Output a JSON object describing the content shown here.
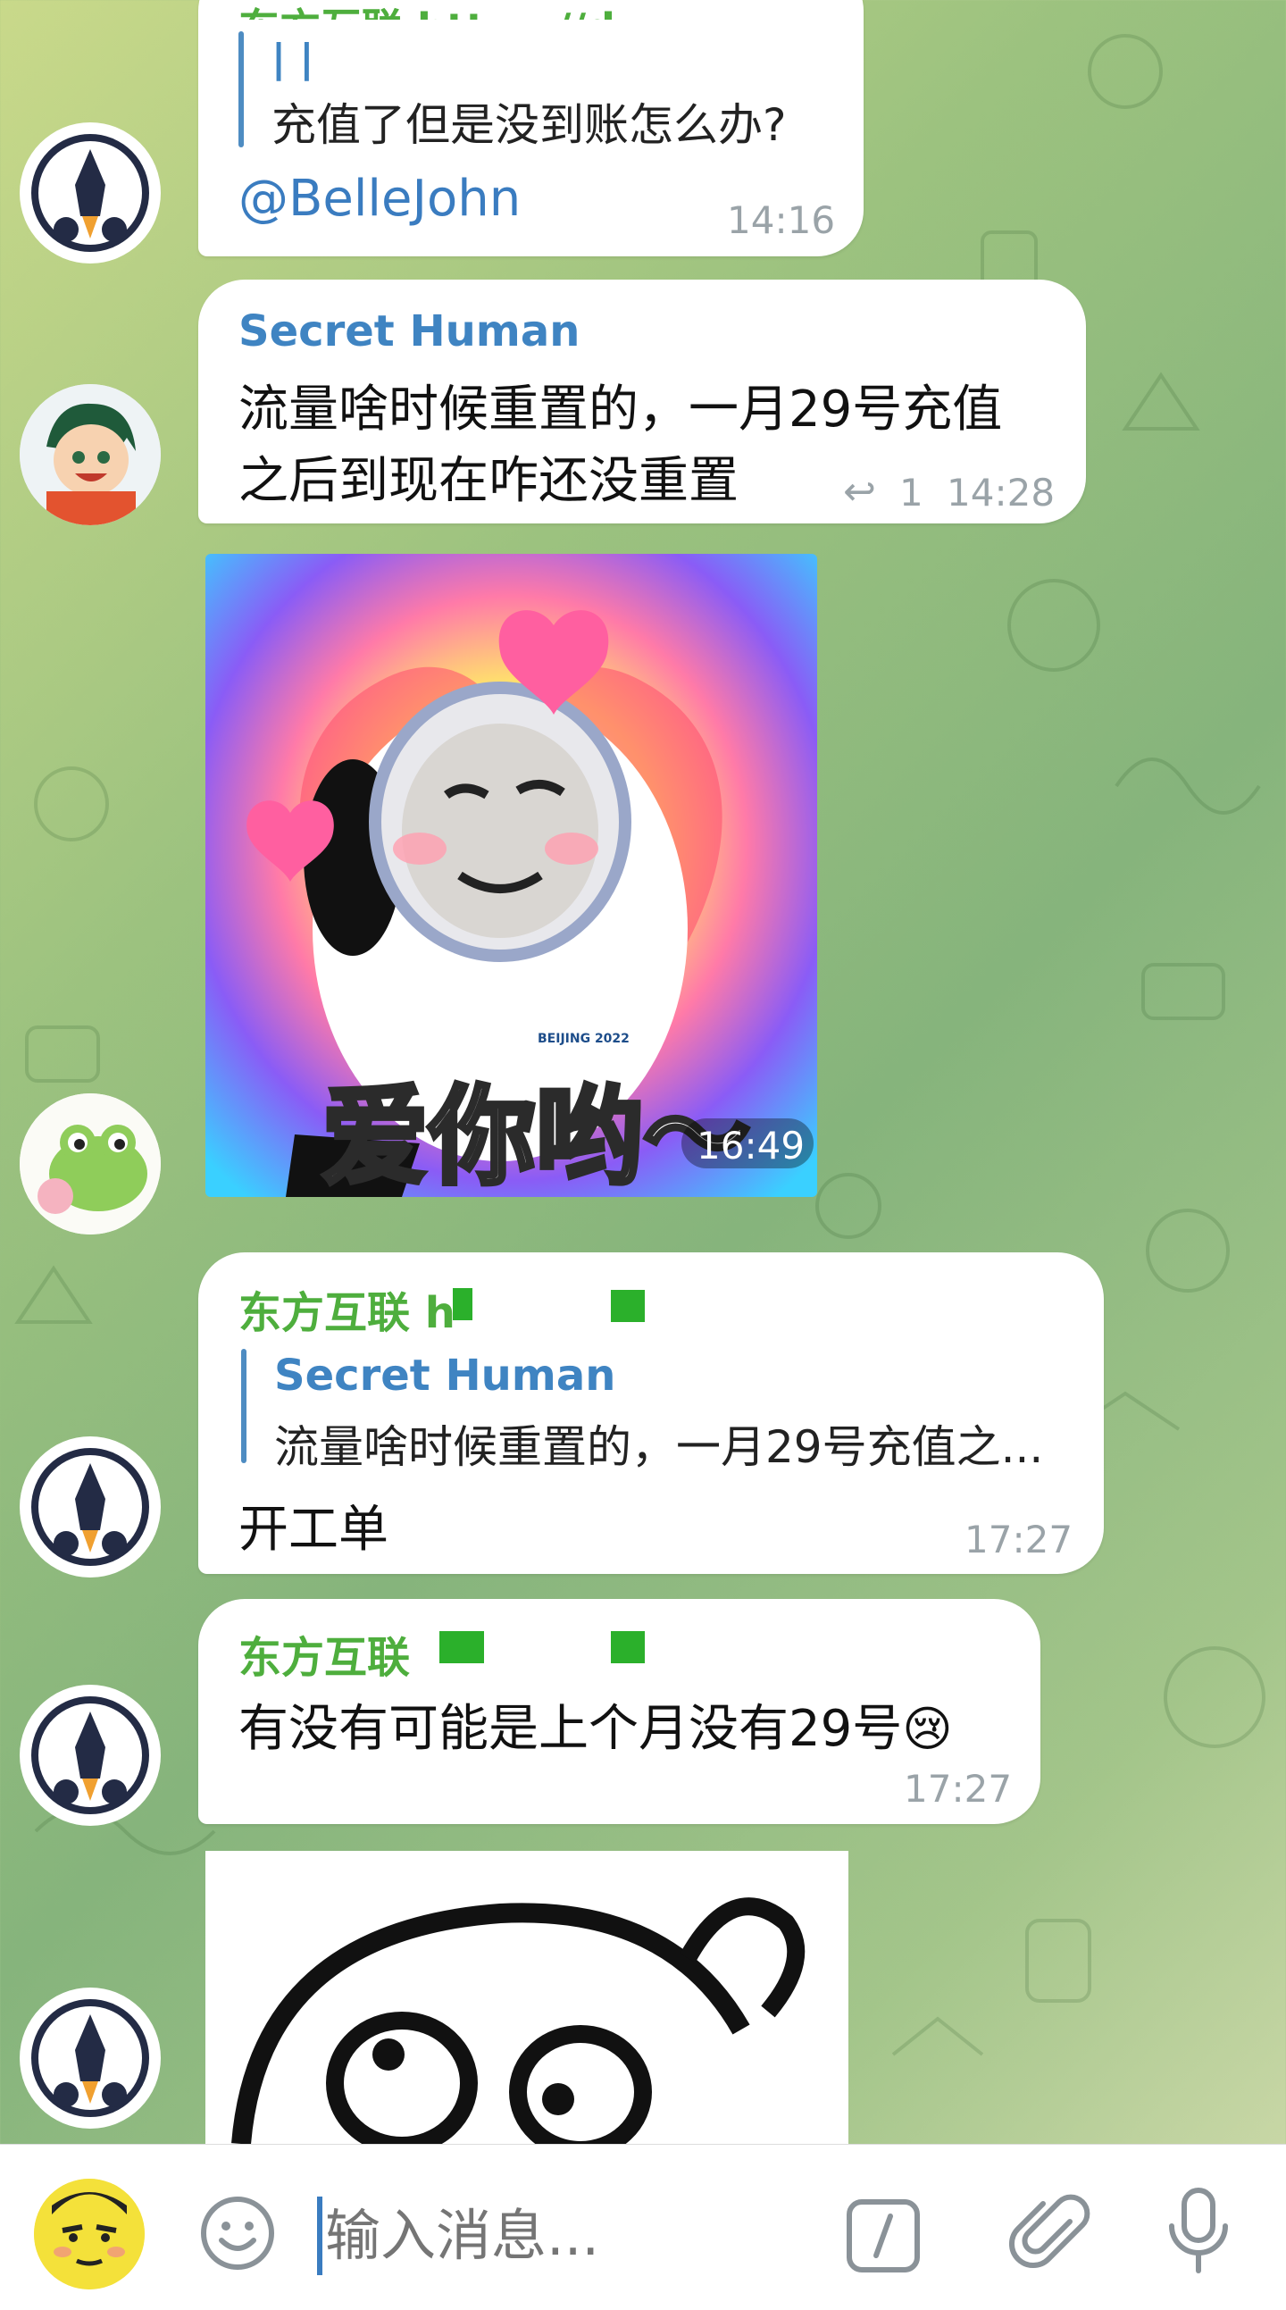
{
  "messages": {
    "m1": {
      "sender_partial": "东方互联 https://de ...",
      "quote_text": "充值了但是没到账怎么办?",
      "mention": "@BelleJohn",
      "time": "14:16"
    },
    "m2": {
      "sender": "Secret Human",
      "line1": "流量啥时候重置的，一月29号充值",
      "line2": "之后到现在咋还没重置",
      "reply_count": "1",
      "time": "14:28"
    },
    "m3": {
      "sticker_caption": "爱你哟～",
      "sticker_tag": "BEIJING 2022",
      "time": "16:49"
    },
    "m4": {
      "sender": "东方互联 h",
      "quote_sender": "Secret Human",
      "quote_text": "流量啥时候重置的，一月29号充值之...",
      "text": "开工单",
      "time": "17:27"
    },
    "m5": {
      "sender": "东方互联",
      "text": "有没有可能是上个月没有29号",
      "emoji": "😢",
      "time": "17:27"
    }
  },
  "input": {
    "placeholder": "输入消息..."
  },
  "icons": {
    "emoji": "smiley-icon",
    "command": "slash-command-icon",
    "attach": "paperclip-icon",
    "mic": "microphone-icon"
  },
  "colors": {
    "sender_green": "#4eae3d",
    "sender_blue": "#3f84c2",
    "link": "#3a7cc0",
    "time_gray": "#9aa3a8"
  }
}
